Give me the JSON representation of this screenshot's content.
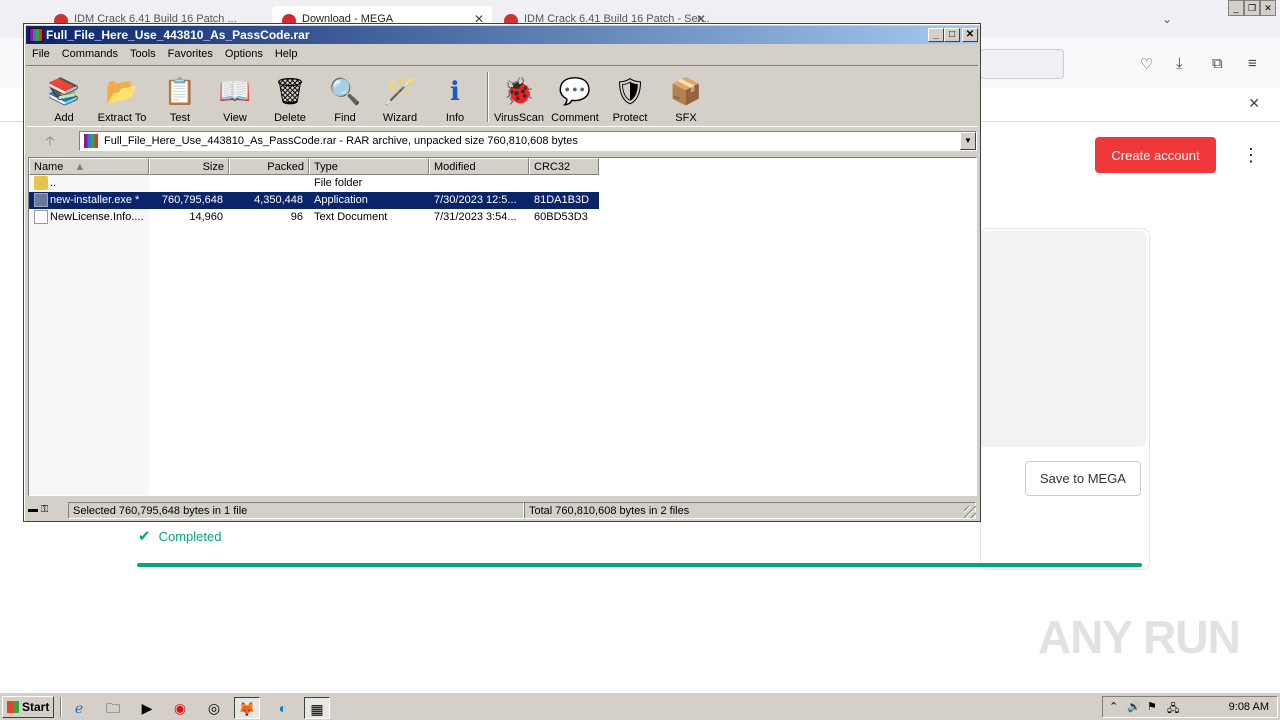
{
  "browser": {
    "tabs": [
      {
        "label": "IDM Crack 6.41 Build 16 Patch ..."
      },
      {
        "label": "Download - MEGA"
      },
      {
        "label": "IDM Crack 6.41 Build 16 Patch - Ser..."
      }
    ],
    "notification_close": "✕"
  },
  "mega": {
    "create_account": "Create account",
    "save_to_mega": "Save to MEGA",
    "completed": "Completed",
    "progress": 1.0
  },
  "watermark": "ANY RUN",
  "winrar": {
    "title": "Full_File_Here_Use_443810_As_PassCode.rar",
    "menu": [
      "File",
      "Commands",
      "Tools",
      "Favorites",
      "Options",
      "Help"
    ],
    "toolbar": [
      {
        "label": "Add",
        "icon": "add-icon",
        "glyph": "📚"
      },
      {
        "label": "Extract To",
        "icon": "extract-icon",
        "glyph": "📂"
      },
      {
        "label": "Test",
        "icon": "test-icon",
        "glyph": "📋"
      },
      {
        "label": "View",
        "icon": "view-icon",
        "glyph": "📖"
      },
      {
        "label": "Delete",
        "icon": "delete-icon",
        "glyph": "🗑"
      },
      {
        "label": "Find",
        "icon": "find-icon",
        "glyph": "🔍"
      },
      {
        "label": "Wizard",
        "icon": "wizard-icon",
        "glyph": "🪄"
      },
      {
        "label": "Info",
        "icon": "info-icon",
        "glyph": "ℹ"
      },
      {
        "label": "VirusScan",
        "icon": "virusscan-icon",
        "glyph": "🐞"
      },
      {
        "label": "Comment",
        "icon": "comment-icon",
        "glyph": "💬"
      },
      {
        "label": "Protect",
        "icon": "protect-icon",
        "glyph": "🛡"
      },
      {
        "label": "SFX",
        "icon": "sfx-icon",
        "glyph": "📦"
      }
    ],
    "address": "Full_File_Here_Use_443810_As_PassCode.rar - RAR archive, unpacked size 760,810,608 bytes",
    "columns": {
      "name": "Name",
      "size": "Size",
      "packed": "Packed",
      "type": "Type",
      "modified": "Modified",
      "crc": "CRC32"
    },
    "files": [
      {
        "name": "..",
        "size": "",
        "packed": "",
        "type": "File folder",
        "modified": "",
        "crc": "",
        "selected": false
      },
      {
        "name": "new-installer.exe *",
        "size": "760,795,648",
        "packed": "4,350,448",
        "type": "Application",
        "modified": "7/30/2023 12:5...",
        "crc": "81DA1B3D",
        "selected": true
      },
      {
        "name": "NewLicense.Info....",
        "size": "14,960",
        "packed": "96",
        "type": "Text Document",
        "modified": "7/31/2023 3:54...",
        "crc": "60BD53D3",
        "selected": false
      }
    ],
    "status_left": "Selected 760,795,648 bytes in 1 file",
    "status_right": "Total 760,810,608 bytes in 2 files"
  },
  "taskbar": {
    "start": "Start",
    "clock": "9:08 AM"
  },
  "colors": {
    "titlebar": "#0a246a",
    "mega_red": "#f0373a",
    "mega_green": "#04a57d"
  }
}
